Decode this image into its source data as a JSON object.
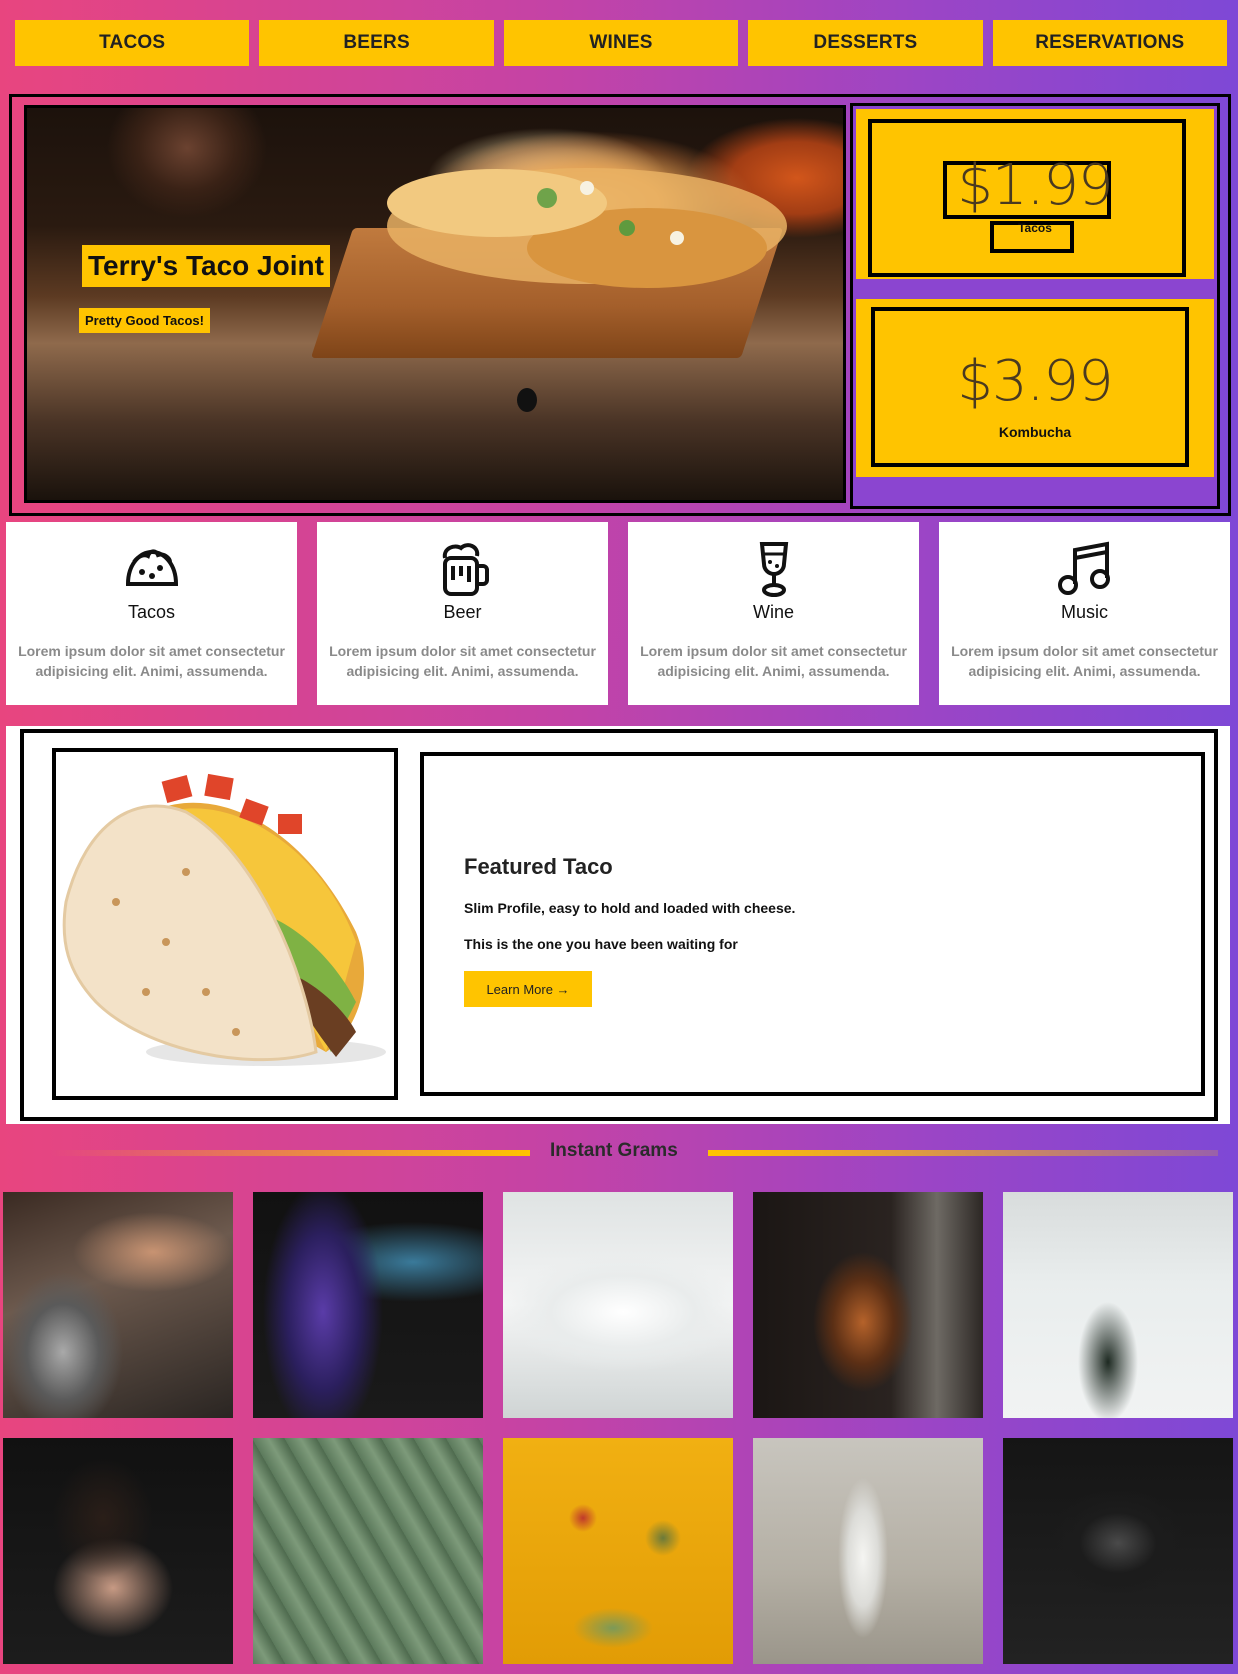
{
  "nav": [
    "TACOS",
    "BEERS",
    "WINES",
    "DESSERTS",
    "RESERVATIONS"
  ],
  "hero": {
    "title": "Terry's Taco Joint",
    "subtitle": "Pretty Good Tacos!"
  },
  "prices": [
    {
      "value": "$1.99",
      "name": "Tacos"
    },
    {
      "value": "$3.99",
      "name": "Kombucha"
    }
  ],
  "features": [
    {
      "icon": "taco-icon",
      "title": "Tacos",
      "desc": "Lorem ipsum dolor sit amet consectetur adipisicing elit. Animi, assumenda."
    },
    {
      "icon": "beer-mug-icon",
      "title": "Beer",
      "desc": "Lorem ipsum dolor sit amet consectetur adipisicing elit. Animi, assumenda."
    },
    {
      "icon": "wine-glass-icon",
      "title": "Wine",
      "desc": "Lorem ipsum dolor sit amet consectetur adipisicing elit. Animi, assumenda."
    },
    {
      "icon": "music-note-icon",
      "title": "Music",
      "desc": "Lorem ipsum dolor sit amet consectetur adipisicing elit. Animi, assumenda."
    }
  ],
  "featured": {
    "title": "Featured Taco",
    "line1": "Slim Profile, easy to hold and loaded with cheese.",
    "line2": "This is the one you have been waiting for",
    "button": "Learn More →"
  },
  "grams": {
    "title": "Instant Grams"
  },
  "colors": {
    "accent": "#ffc400",
    "gradient_start": "#e8457f",
    "gradient_end": "#7e48d6"
  }
}
